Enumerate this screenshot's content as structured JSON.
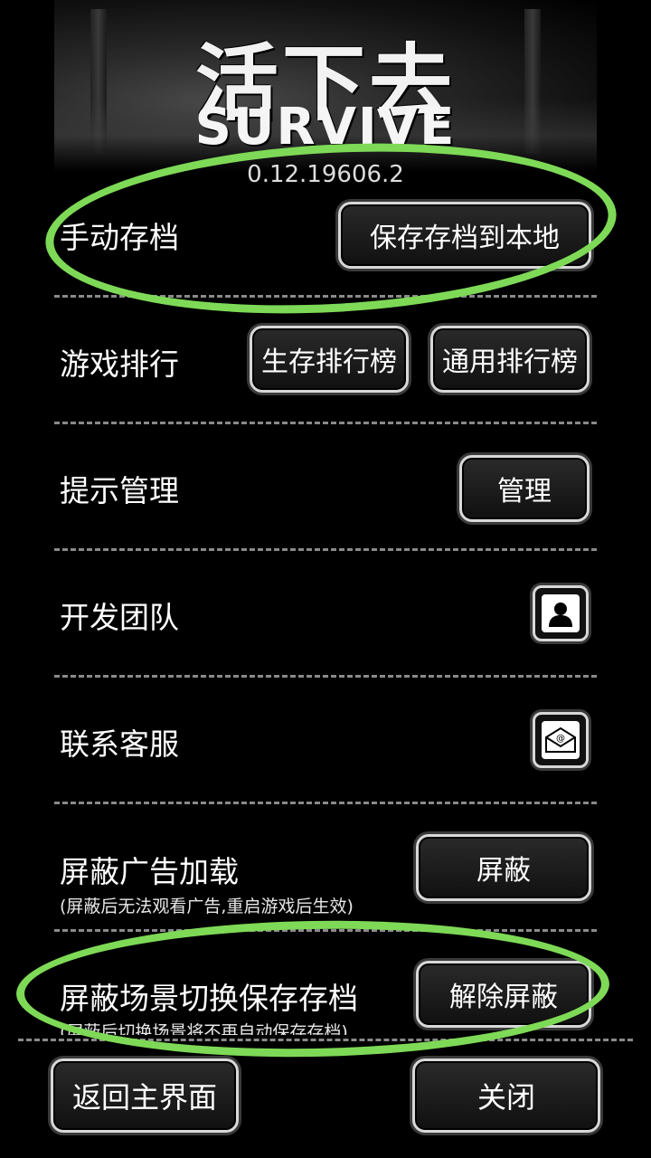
{
  "header": {
    "logo_cn": "活下去",
    "logo_en": "SURVIVE",
    "version": "0.12.19606.2"
  },
  "rows": [
    {
      "label": "手动存档",
      "buttons": [
        "保存存档到本地"
      ]
    },
    {
      "label": "游戏排行",
      "buttons": [
        "生存排行榜",
        "通用排行榜"
      ]
    },
    {
      "label": "提示管理",
      "buttons": [
        "管理"
      ]
    },
    {
      "label": "开发团队",
      "icon": "person-icon"
    },
    {
      "label": "联系客服",
      "icon": "email-icon"
    },
    {
      "label": "屏蔽广告加载",
      "sublabel": "(屏蔽后无法观看广告,重启游戏后生效)",
      "buttons": [
        "屏蔽"
      ]
    },
    {
      "label": "屏蔽场景切换保存存档",
      "sublabel": "(屏蔽后切换场景将不再自动保存存档)",
      "buttons": [
        "解除屏蔽"
      ]
    }
  ],
  "footer": {
    "back_label": "返回主界面",
    "close_label": "关闭"
  },
  "colors": {
    "background": "#000000",
    "annotation": "#7ed957",
    "divider": "#8a8a8a"
  }
}
